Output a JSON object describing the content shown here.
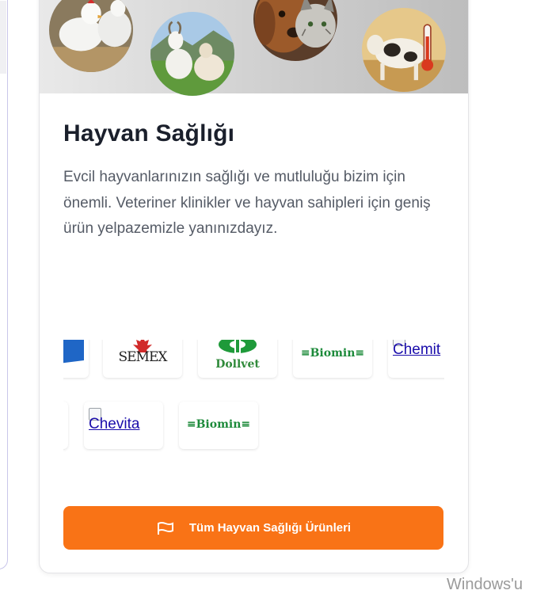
{
  "card": {
    "title": "Hayvan Sağlığı",
    "description": "Evcil hayvanlarınızın sağlığı ve mutluluğu bizim için önemli. Veteriner klinikler ve hayvan sahipleri için geniş ürün yelpazemizle yanınızdayız.",
    "hero_images": [
      "chickens",
      "goat-and-sheep",
      "dog-and-cat",
      "cow-with-thermometer"
    ]
  },
  "brand_logos": {
    "row1": [
      "",
      "SEMEX",
      "Dollvet",
      "≡Biomin≡",
      "Chemit"
    ],
    "row2": [
      "",
      "Chevita",
      "≡Biomin≡"
    ]
  },
  "cta": {
    "label": "Tüm Hayvan Sağlığı Ürünleri",
    "icon": "flag-icon"
  },
  "colors": {
    "accent": "#f97316",
    "title": "#1a1f2b",
    "text": "#555b66",
    "biomin_green": "#1c8a3a",
    "dollvet_green": "#1f9a3a",
    "link": "#1a0dab"
  },
  "watermark": "Windows'u"
}
